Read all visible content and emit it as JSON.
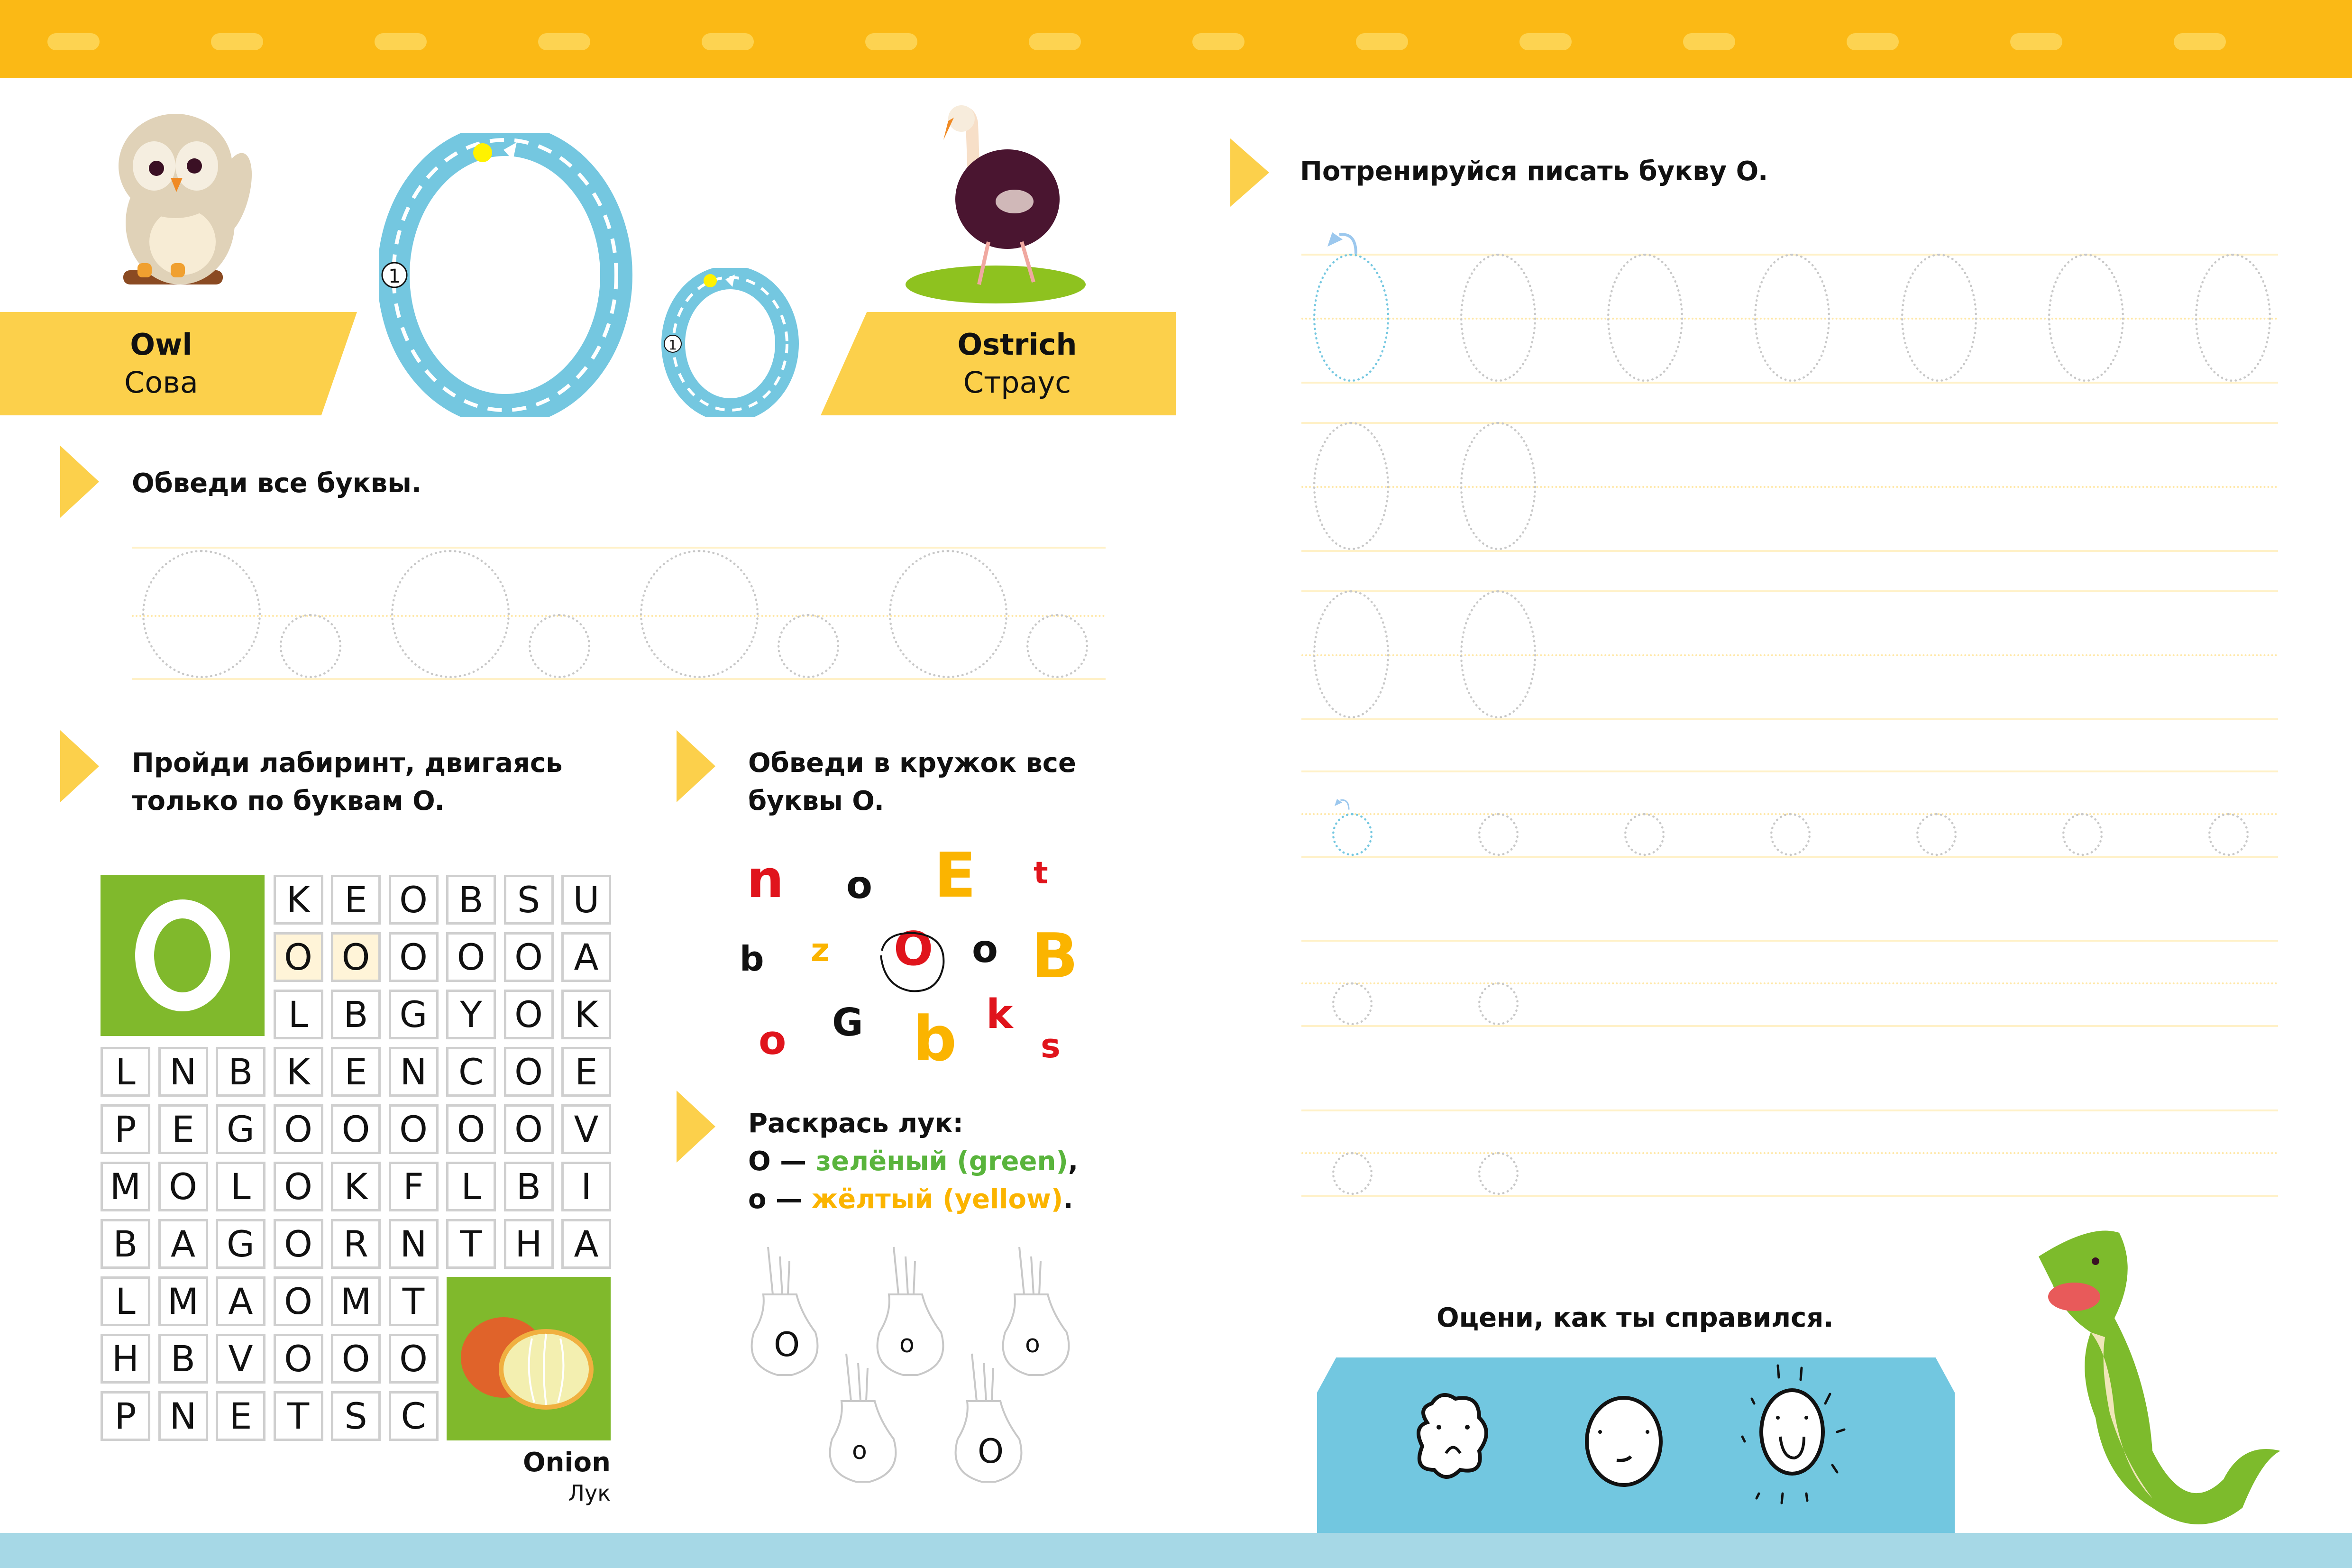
{
  "colors": {
    "accent_yellow": "#fbb915",
    "band_yellow": "#fcd04b",
    "letter_blue": "#74c7e0",
    "maze_green": "#80b92c",
    "red": "#e0141c",
    "orange": "#fbb400",
    "green_text": "#59b43c"
  },
  "header": {
    "left_word": {
      "en": "Owl",
      "ru": "Сова",
      "icon": "owl-illustration"
    },
    "right_word": {
      "en": "Ostrich",
      "ru": "Страус",
      "icon": "ostrich-illustration"
    },
    "big_letter": {
      "letter": "O",
      "step": "1"
    },
    "small_letter": {
      "letter": "o",
      "step": "1"
    }
  },
  "trace_section": {
    "instruction": "Обведи все буквы.",
    "letters": [
      "O",
      "o",
      "O",
      "o",
      "O",
      "o",
      "O",
      "o"
    ]
  },
  "maze_section": {
    "instruction_line1": "Пройди лабиринт, двигаясь",
    "instruction_line2": "только по буквам O.",
    "start_letter": "O",
    "rows": [
      [
        "",
        "",
        "",
        "K",
        "E",
        "O",
        "B",
        "S",
        "U"
      ],
      [
        "",
        "",
        "",
        "O",
        "O",
        "O",
        "O",
        "O",
        "A"
      ],
      [
        "",
        "",
        "",
        "L",
        "B",
        "G",
        "Y",
        "O",
        "K"
      ],
      [
        "L",
        "N",
        "B",
        "K",
        "E",
        "N",
        "C",
        "O",
        "E"
      ],
      [
        "P",
        "E",
        "G",
        "O",
        "O",
        "O",
        "O",
        "O",
        "V"
      ],
      [
        "M",
        "O",
        "L",
        "O",
        "K",
        "F",
        "L",
        "B",
        "I"
      ],
      [
        "B",
        "A",
        "G",
        "O",
        "R",
        "N",
        "T",
        "H",
        "A"
      ],
      [
        "L",
        "M",
        "A",
        "O",
        "M",
        "T",
        "",
        "",
        ""
      ],
      [
        "H",
        "B",
        "V",
        "O",
        "O",
        "O",
        "",
        "",
        ""
      ],
      [
        "P",
        "N",
        "E",
        "T",
        "S",
        "C",
        "",
        "",
        ""
      ]
    ],
    "highlighted_cells": [
      "1-3",
      "1-4"
    ],
    "goal": {
      "en": "Onion",
      "ru": "Лук",
      "icon": "onion-illustration"
    }
  },
  "circle_section": {
    "instruction_line1": "Обведи в кружок все",
    "instruction_line2": "буквы O.",
    "letters": [
      {
        "char": "n",
        "color": "red"
      },
      {
        "char": "o",
        "color": "black"
      },
      {
        "char": "E",
        "color": "orange"
      },
      {
        "char": "t",
        "color": "red"
      },
      {
        "char": "b",
        "color": "black"
      },
      {
        "char": "z",
        "color": "orange"
      },
      {
        "char": "O",
        "color": "red",
        "circled": true
      },
      {
        "char": "o",
        "color": "black"
      },
      {
        "char": "B",
        "color": "orange"
      },
      {
        "char": "o",
        "color": "red"
      },
      {
        "char": "G",
        "color": "black"
      },
      {
        "char": "b",
        "color": "orange"
      },
      {
        "char": "k",
        "color": "red"
      },
      {
        "char": "s",
        "color": "red"
      }
    ]
  },
  "color_section": {
    "instruction": "Раскрась лук:",
    "line2_prefix": "O — ",
    "line2_color": "зелёный (green)",
    "line2_suffix": ",",
    "line3_prefix": "o — ",
    "line3_color": "жёлтый (yellow)",
    "line3_suffix": ".",
    "onions": [
      "O",
      "o",
      "o",
      "o",
      "O"
    ]
  },
  "practice_section": {
    "instruction": "Потренируйся писать букву O.",
    "big_rows": [
      7,
      2,
      2
    ],
    "small_rows": [
      7,
      2,
      2
    ]
  },
  "rating_section": {
    "instruction": "Оцени, как ты справился.",
    "faces": [
      "sad-cloud-face-icon",
      "neutral-face-icon",
      "happy-sun-face-icon"
    ]
  }
}
